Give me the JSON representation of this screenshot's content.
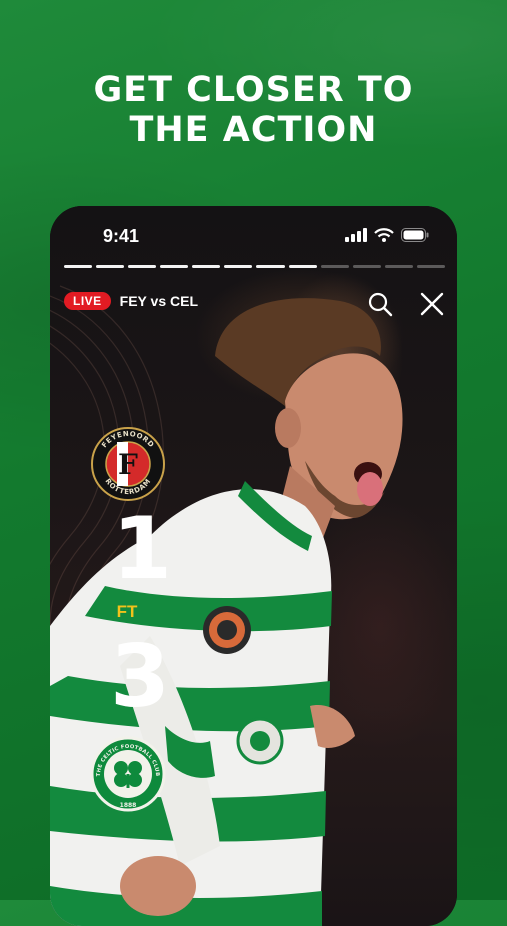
{
  "headline": {
    "line1": "GET CLOSER TO",
    "line2": "THE ACTION"
  },
  "status_bar": {
    "time": "9:41"
  },
  "story_progress": {
    "total_segments": 12,
    "completed_segments": 8
  },
  "top_bar": {
    "live_badge": "LIVE",
    "match_title": "FEY vs CEL"
  },
  "scoreboard": {
    "home_score": "1",
    "status": "FT",
    "away_score": "3",
    "home_crest_top_text": "FEYENOORD",
    "home_crest_bottom_text": "ROTTERDAM",
    "home_crest_letter": "F",
    "away_crest_text": "THE CELTIC FOOTBALL CLUB",
    "away_crest_year": "1888"
  },
  "colors": {
    "background_green": "#137a2e",
    "live_red": "#e21b23",
    "ft_yellow": "#f2c21b",
    "celtic_green": "#0e8a3c"
  }
}
